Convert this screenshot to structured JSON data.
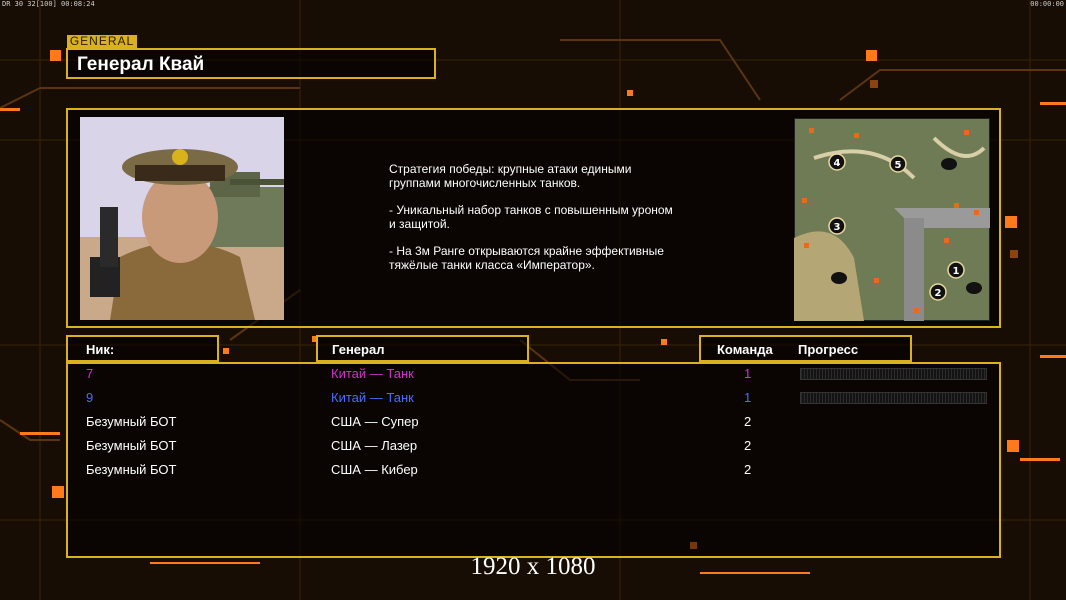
{
  "hud": {
    "left": "DR 30 32[100] 00:08:24",
    "right": "00:00:00"
  },
  "header": {
    "tag": "GENERAL",
    "title": "Генерал Квай"
  },
  "description": [
    "Стратегия победы: крупные атаки едиными\n группами многочисленных танков.",
    "- Уникальный набор танков с повышенным уроном\n и защитой.",
    "- На 3м Ранге открываются крайне эффективные\n тяжёлые танки класса «Император»."
  ],
  "map": {
    "markers": [
      "4",
      "5",
      "3",
      "1",
      "2"
    ]
  },
  "columns": {
    "nick": "Ник:",
    "general": "Генерал",
    "team": "Команда",
    "progress": "Прогресс"
  },
  "players": [
    {
      "nick": "7",
      "general": "Китай — Танк",
      "team": "1",
      "color": "#cc33cc",
      "has_progress": true
    },
    {
      "nick": "9",
      "general": "Китай — Танк",
      "team": "1",
      "color": "#4d6bff",
      "has_progress": true
    },
    {
      "nick": "Безумный БОТ",
      "general": "США — Супер",
      "team": "2",
      "color": "#ffffff",
      "has_progress": false
    },
    {
      "nick": "Безумный БОТ",
      "general": "США — Лазер",
      "team": "2",
      "color": "#ffffff",
      "has_progress": false
    },
    {
      "nick": "Безумный БОТ",
      "general": "США — Кибер",
      "team": "2",
      "color": "#ffffff",
      "has_progress": false
    }
  ],
  "resolution": "1920 x 1080",
  "colors": {
    "accent": "#d9b21d",
    "orange": "#ff7a1a",
    "background": "#170d05"
  }
}
